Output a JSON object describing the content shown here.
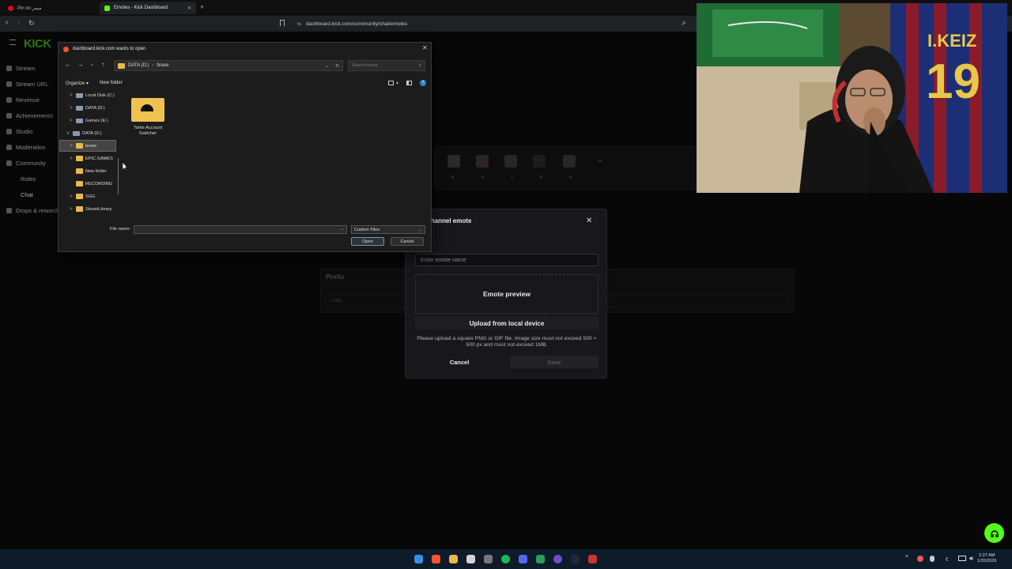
{
  "browser": {
    "tabs": [
      {
        "label": "Pin on ميمز",
        "active": false
      },
      {
        "label": "Emotes - Kick Dashboard",
        "active": true
      }
    ],
    "address": "dashboard.kick.com/community/chat/emotes"
  },
  "sidebar": {
    "logo": "KICK",
    "items": [
      {
        "label": "Stream",
        "icon": "broadcast-icon"
      },
      {
        "label": "Stream URL",
        "icon": "link-icon"
      },
      {
        "label": "Revenue",
        "icon": "money-icon"
      },
      {
        "label": "Achievements",
        "icon": "trophy-icon"
      },
      {
        "label": "Studio",
        "icon": "studio-icon"
      },
      {
        "label": "Moderation",
        "icon": "shield-icon"
      },
      {
        "label": "Community",
        "icon": "users-icon"
      },
      {
        "label": "Roles",
        "icon": ""
      },
      {
        "label": "Chat",
        "icon": ""
      },
      {
        "label": "Drops & rewards",
        "icon": "gift-icon"
      }
    ]
  },
  "emote_slots": [
    "5",
    "6",
    "7",
    "8",
    "9"
  ],
  "prefix": {
    "label": "Prefix",
    "value": "i-keiz"
  },
  "file_dialog": {
    "title": "dashboard.kick.com wants to open",
    "path": [
      "DATA (D:)",
      "brave"
    ],
    "search_placeholder": "Search brave",
    "organize": "Organize",
    "new_folder": "New folder",
    "tree": [
      {
        "label": "Local Disk (C:)",
        "kind": "drive",
        "indent": 1,
        "expand": ">"
      },
      {
        "label": "DATA (D:)",
        "kind": "drive",
        "indent": 1,
        "expand": ">"
      },
      {
        "label": "Games (E:)",
        "kind": "drive",
        "indent": 1,
        "expand": ">"
      },
      {
        "label": "DATA (D:)",
        "kind": "drive",
        "indent": 0,
        "expand": "v"
      },
      {
        "label": "brave",
        "kind": "folder",
        "indent": 1,
        "expand": ">",
        "selected": true
      },
      {
        "label": "EPIC GAMES",
        "kind": "folder",
        "indent": 1,
        "expand": ">"
      },
      {
        "label": "New folder",
        "kind": "folder",
        "indent": 1,
        "expand": ""
      },
      {
        "label": "RECORDING",
        "kind": "folder",
        "indent": 1,
        "expand": ""
      },
      {
        "label": "SGG",
        "kind": "folder",
        "indent": 1,
        "expand": ">"
      },
      {
        "label": "SteamLibrary",
        "kind": "folder",
        "indent": 1,
        "expand": ">"
      }
    ],
    "files": [
      {
        "label": "Tohle Account Switcher",
        "kind": "folder"
      }
    ],
    "file_name_label": "File name:",
    "file_name_value": "",
    "file_type": "Custom Files",
    "open": "Open",
    "cancel": "Cancel"
  },
  "emote_modal": {
    "title": "Channel emote",
    "name_placeholder": "Enter emote name",
    "preview": "Emote preview",
    "upload": "Upload from local device",
    "hint": "Please upload a square PNG or GIF file. Image size must not exceed 500 × 500 px and must not exceed 1MB.",
    "cancel": "Cancel",
    "save": "Save"
  },
  "taskbar": {
    "time": "2:27 AM",
    "date": "1/20/2026"
  },
  "colors": {
    "kick_green": "#53fc18",
    "dialog_bg": "#1c1c1c",
    "folder": "#e9b949"
  }
}
